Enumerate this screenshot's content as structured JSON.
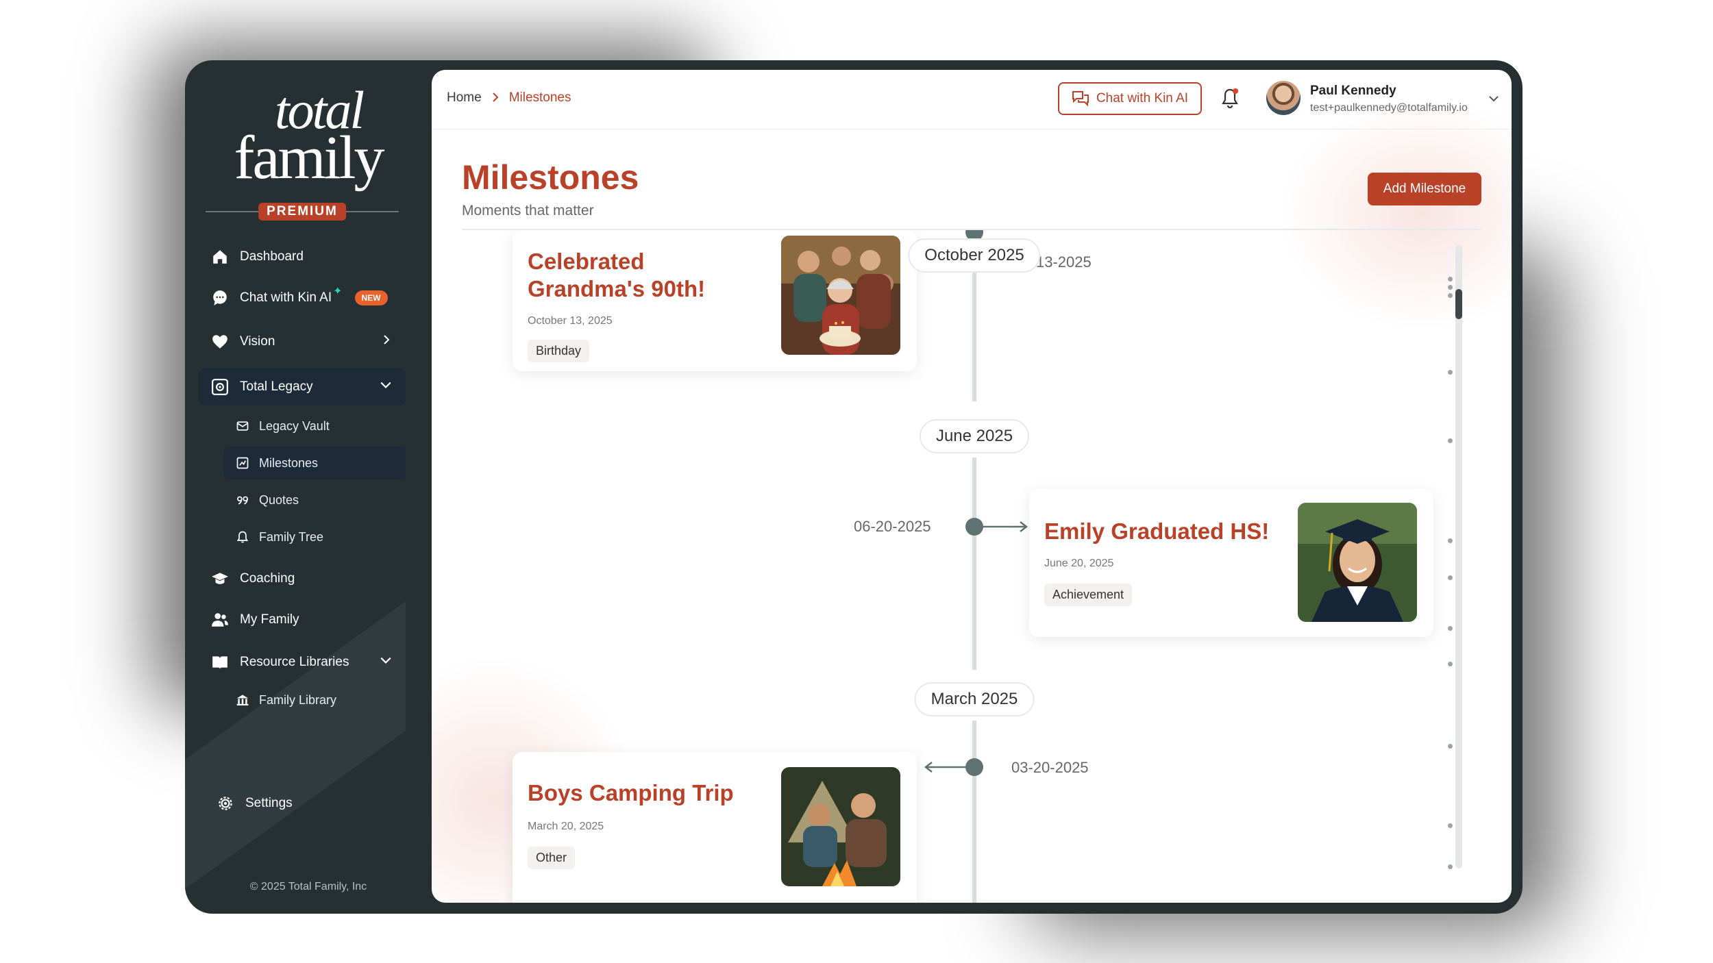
{
  "brand": {
    "logo_line1": "total",
    "logo_line2": "family",
    "tier": "PREMIUM"
  },
  "sidebar": {
    "items": [
      {
        "label": "Dashboard",
        "icon": "home-icon"
      },
      {
        "label": "Chat with Kin AI",
        "icon": "chat-bubble-icon",
        "badge": "NEW",
        "sparkle": "✦"
      },
      {
        "label": "Vision",
        "icon": "heart-icon"
      },
      {
        "label": "Total Legacy",
        "icon": "vault-icon"
      },
      {
        "label": "Coaching",
        "icon": "graduation-cap-icon"
      },
      {
        "label": "My Family",
        "icon": "users-icon"
      },
      {
        "label": "Resource Libraries",
        "icon": "book-icon"
      }
    ],
    "legacy_sub": [
      {
        "label": "Legacy Vault",
        "icon": "envelope-icon"
      },
      {
        "label": "Milestones",
        "icon": "milestone-icon"
      },
      {
        "label": "Quotes",
        "icon": "quote-icon"
      },
      {
        "label": "Family Tree",
        "icon": "bell-tree-icon"
      }
    ],
    "library_sub": [
      {
        "label": "Family Library",
        "icon": "building-icon"
      }
    ],
    "settings_label": "Settings",
    "copyright": "© 2025 Total Family, Inc"
  },
  "header": {
    "breadcrumb": [
      "Home",
      "Milestones"
    ],
    "chat_button": "Chat with Kin AI",
    "user": {
      "name": "Paul Kennedy",
      "email": "test+paulkennedy@totalfamily.io"
    }
  },
  "page": {
    "title": "Milestones",
    "subtitle": "Moments that matter",
    "add_button": "Add Milestone"
  },
  "timeline": {
    "months": [
      "October 2025",
      "June 2025",
      "March 2025"
    ],
    "milestones": [
      {
        "title_line1": "Celebrated",
        "title_line2": "Grandma's 90th!",
        "date": "October 13, 2025",
        "tag": "Birthday",
        "short_date": "10-13-2025",
        "short_date_visible": "13-2025"
      },
      {
        "title": "Emily Graduated HS!",
        "date": "June 20, 2025",
        "tag": "Achievement",
        "short_date": "06-20-2025"
      },
      {
        "title": "Boys Camping Trip",
        "date": "March 20, 2025",
        "tag": "Other",
        "short_date": "03-20-2025"
      }
    ]
  },
  "colors": {
    "accent": "#b84128",
    "sidebar": "#263033",
    "active": "#1d2a39",
    "badge": "#e8622c",
    "node": "#5e7274"
  }
}
